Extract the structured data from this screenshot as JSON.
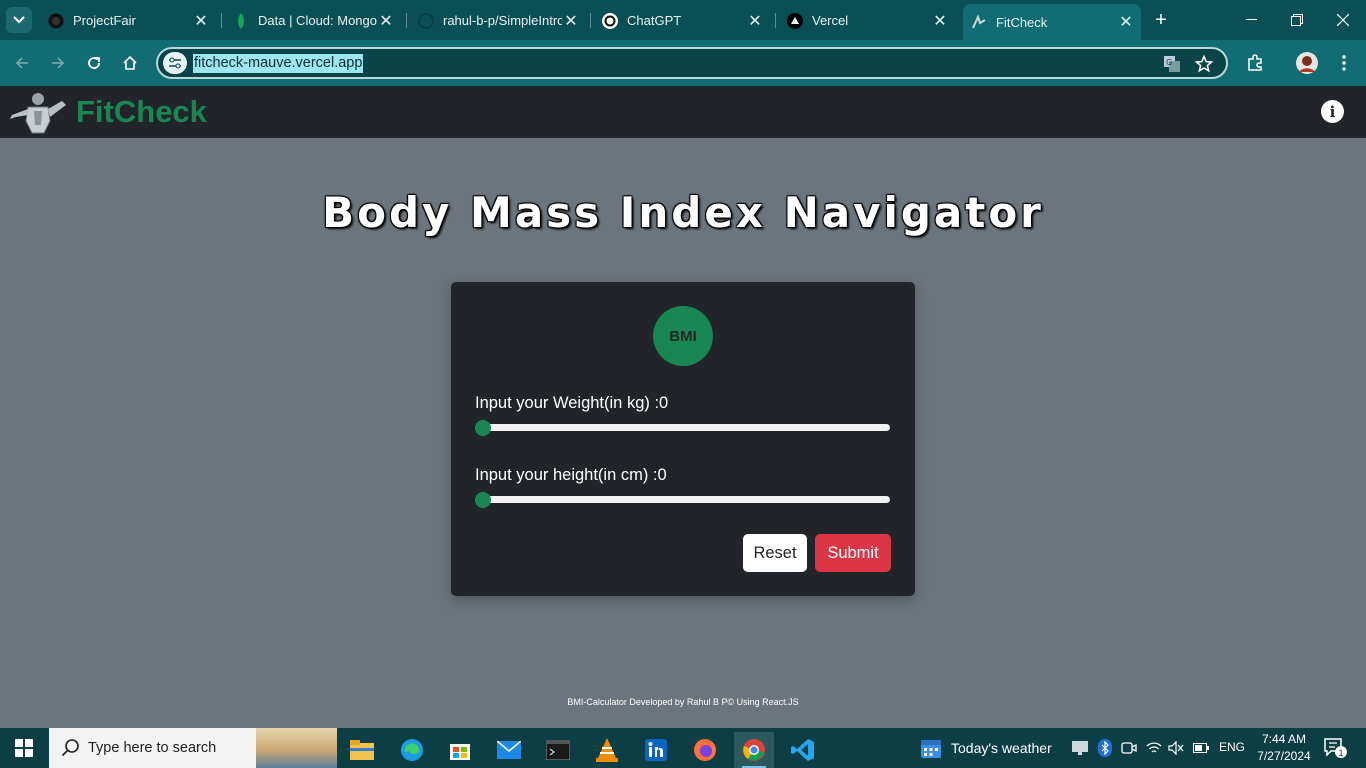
{
  "browser": {
    "tabs": [
      {
        "title": "ProjectFair",
        "icon": "github-icon",
        "active": false
      },
      {
        "title": "Data | Cloud: MongoD",
        "icon": "mongodb-leaf-icon",
        "active": false
      },
      {
        "title": "rahul-b-p/SimpleIntro",
        "icon": "github-icon",
        "active": false
      },
      {
        "title": "ChatGPT",
        "icon": "chatgpt-icon",
        "active": false
      },
      {
        "title": "Vercel",
        "icon": "vercel-triangle-icon",
        "active": false
      },
      {
        "title": "FitCheck",
        "icon": "fitcheck-logo-icon",
        "active": true
      }
    ],
    "url": "fitcheck-mauve.vercel.app",
    "colors": {
      "frame": "#0a4f55",
      "toolbar": "#116d73"
    }
  },
  "app": {
    "brand": "FitCheck",
    "heading": "Body Mass Index Navigator",
    "badge": "BMI",
    "weight_label": "Input your Weight(in kg) :0",
    "height_label": "Input your height(in cm) :0",
    "weight_value": 0,
    "height_value": 0,
    "reset_label": "Reset",
    "submit_label": "Submit",
    "footer": "BMI-Calculator Developed by Rahul B P© Using React.JS",
    "colors": {
      "accent": "#198754",
      "danger": "#dc3545",
      "navbar": "#212529",
      "background": "#6c757d"
    }
  },
  "taskbar": {
    "search_placeholder": "Type here to search",
    "weather": "Today's weather",
    "language": "ENG",
    "time": "7:44 AM",
    "date": "7/27/2024",
    "notification_count": "1"
  }
}
